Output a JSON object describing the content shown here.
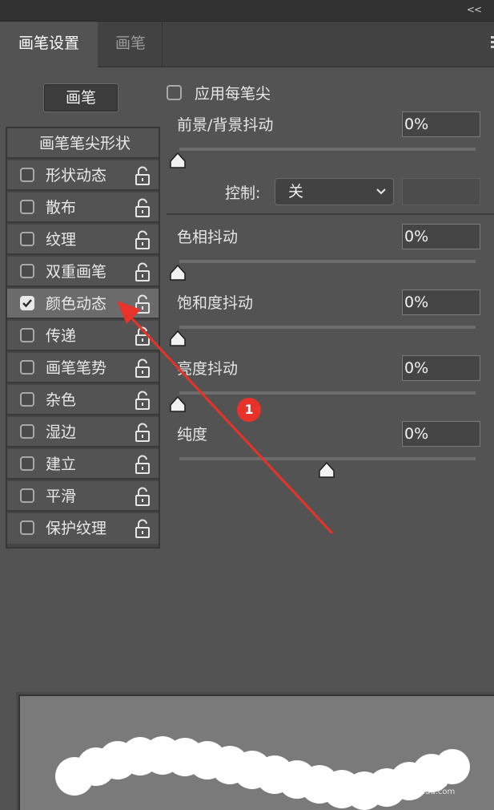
{
  "topbar": {
    "collapse_label": "<<"
  },
  "tabs": [
    {
      "label": "画笔设置",
      "active": true
    },
    {
      "label": "画笔",
      "active": false
    }
  ],
  "brush_button": {
    "label": "画笔"
  },
  "brush_list": {
    "header": "画笔笔尖形状",
    "items": [
      {
        "label": "形状动态",
        "checked": false
      },
      {
        "label": "散布",
        "checked": false
      },
      {
        "label": "纹理",
        "checked": false
      },
      {
        "label": "双重画笔",
        "checked": false
      },
      {
        "label": "颜色动态",
        "checked": true
      },
      {
        "label": "传递",
        "checked": false
      },
      {
        "label": "画笔笔势",
        "checked": false
      },
      {
        "label": "杂色",
        "checked": false
      },
      {
        "label": "湿边",
        "checked": false
      },
      {
        "label": "建立",
        "checked": false
      },
      {
        "label": "平滑",
        "checked": false
      },
      {
        "label": "保护纹理",
        "checked": false
      }
    ]
  },
  "apply_per_tip": {
    "label": "应用每笔尖",
    "checked": false
  },
  "fg_bg_jitter": {
    "label": "前景/背景抖动",
    "value": "0%",
    "slider_fraction": 0
  },
  "control": {
    "label": "控制:",
    "selected": "关"
  },
  "hue_jitter": {
    "label": "色相抖动",
    "value": "0%",
    "slider_fraction": 0
  },
  "saturation_jitter": {
    "label": "饱和度抖动",
    "value": "0%",
    "slider_fraction": 0
  },
  "brightness_jitter": {
    "label": "亮度抖动",
    "value": "0%",
    "slider_fraction": 0
  },
  "purity": {
    "label": "纯度",
    "value": "0%",
    "slider_fraction": 0.5
  },
  "annotation": {
    "number": "1",
    "color": "#e8322a"
  },
  "watermark": {
    "text": "Bai 经验",
    "sub": "jingyan.baidu.com"
  },
  "colors": {
    "panel_bg": "#535353",
    "accent_red": "#e8322a"
  }
}
